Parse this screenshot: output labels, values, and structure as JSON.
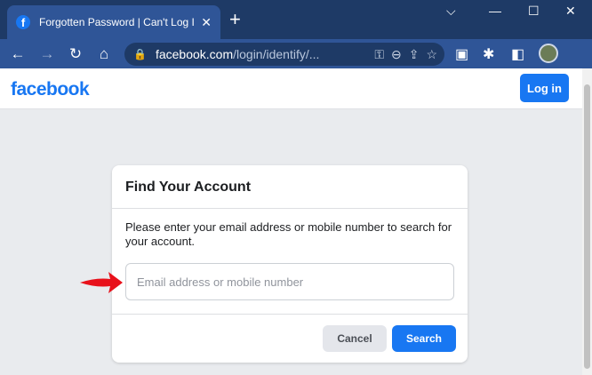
{
  "browser": {
    "tab_title": "Forgotten Password | Can't Log In",
    "tab_favicon": "f",
    "tab_close": "✕",
    "new_tab": "+",
    "window_minimize": "⌵",
    "window_restore": "—",
    "window_maximize": "☐",
    "window_close": "✕",
    "url_host": "facebook.com",
    "url_path": "/login/identify/...",
    "icons": [
      "back-icon",
      "forward-icon",
      "reload-icon",
      "home-icon",
      "lock-icon",
      "key-icon",
      "zoom-icon",
      "share-icon",
      "star-icon",
      "extension-icon",
      "puzzle-icon",
      "sidebar-icon",
      "profile-avatar"
    ],
    "glyphs": {
      "back": "←",
      "forward": "→",
      "reload": "↻",
      "home": "⌂",
      "lock": "🔒",
      "key": "⚿",
      "zoom": "⊖",
      "share": "⇪",
      "star": "☆",
      "ext1": "▣",
      "ext2": "✱",
      "sidebar": "◧"
    }
  },
  "header": {
    "logo": "facebook",
    "login_label": "Log in"
  },
  "card": {
    "title": "Find Your Account",
    "description": "Please enter your email address or mobile number to search for your account.",
    "input_placeholder": "Email address or mobile number",
    "input_value": "",
    "cancel_label": "Cancel",
    "search_label": "Search"
  },
  "colors": {
    "brand": "#1877f2",
    "browser_frame": "#1e3a66",
    "annotation_arrow": "#e8111b"
  }
}
